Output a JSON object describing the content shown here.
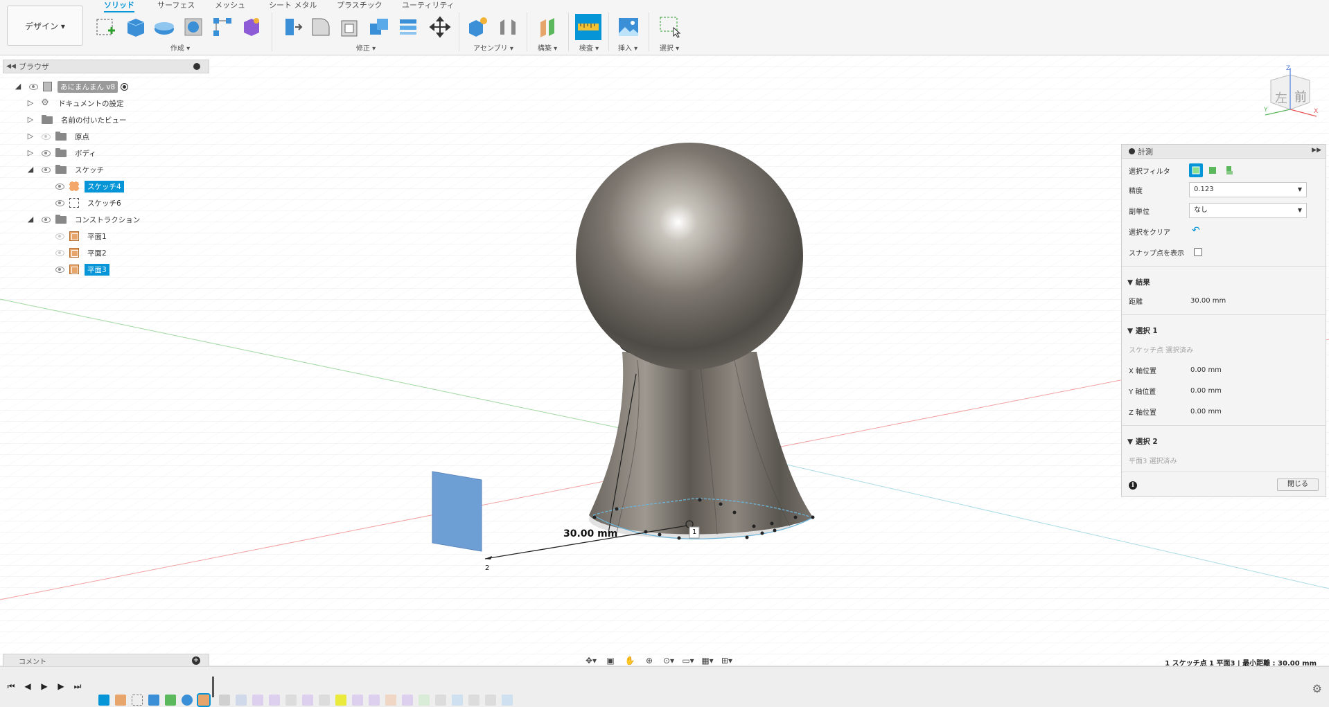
{
  "toolbar": {
    "design_label": "デザイン ▾",
    "tabs": [
      {
        "label": "ソリッド",
        "active": true
      },
      {
        "label": "サーフェス"
      },
      {
        "label": "メッシュ"
      },
      {
        "label": "シート メタル"
      },
      {
        "label": "プラスチック"
      },
      {
        "label": "ユーティリティ"
      }
    ],
    "groups": {
      "create": "作成 ▾",
      "modify": "修正 ▾",
      "assembly": "アセンブリ ▾",
      "construct": "構築 ▾",
      "inspect": "検査 ▾",
      "insert": "挿入 ▾",
      "select": "選択 ▾"
    }
  },
  "browser": {
    "title": "ブラウザ",
    "root": "あにまんまん v8",
    "items": [
      {
        "label": "ドキュメントの設定"
      },
      {
        "label": "名前の付いたビュー"
      },
      {
        "label": "原点"
      },
      {
        "label": "ボディ"
      },
      {
        "label": "スケッチ"
      },
      {
        "label": "スケッチ4"
      },
      {
        "label": "スケッチ6"
      },
      {
        "label": "コンストラクション"
      },
      {
        "label": "平面1"
      },
      {
        "label": "平面2"
      },
      {
        "label": "平面3"
      }
    ]
  },
  "viewcube": {
    "left": "左",
    "front": "前",
    "z": "Z",
    "x": "X",
    "y": "Y"
  },
  "viewport": {
    "dimension_label": "30.00 mm",
    "point1_label": "1",
    "point2_label": "2"
  },
  "inspect_panel": {
    "title": "計測",
    "filter_label": "選択フィルタ",
    "precision_label": "精度",
    "precision_value": "0.123",
    "sub_unit_label": "副単位",
    "sub_unit_value": "なし",
    "clear_label": "選択をクリア",
    "snap_label": "スナップ点を表示",
    "results_section": "結果",
    "distance_label": "距離",
    "distance_value": "30.00 mm",
    "selection1_section": "選択 1",
    "selection1_info": "スケッチ点 選択済み",
    "x_label": "X 軸位置",
    "x_value": "0.00 mm",
    "y_label": "Y 軸位置",
    "y_value": "0.00 mm",
    "z_label": "Z 軸位置",
    "z_value": "0.00 mm",
    "selection2_section": "選択 2",
    "selection2_info": "平面3 選択済み",
    "close_label": "閉じる",
    "info_icon_label": "i"
  },
  "comment": {
    "label": "コメント"
  },
  "status": {
    "text": "1 スケッチ点 1 平面3 | 最小距離 : 30.00 mm"
  },
  "colors": {
    "accent": "#0696d7",
    "panel": "#f4f4f4"
  }
}
